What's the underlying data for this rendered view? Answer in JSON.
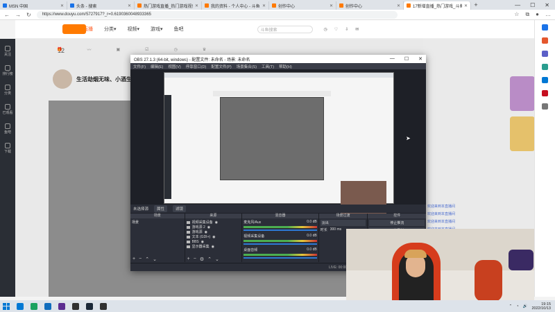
{
  "browser": {
    "tabs": [
      {
        "title": "MSN 中国",
        "color": "#1a73e8",
        "active": false
      },
      {
        "title": "头条 - 搜索",
        "color": "#1a73e8",
        "active": false
      },
      {
        "title": "热门游戏直播_热门游戏视频_热…",
        "color": "#ff7a00",
        "active": false
      },
      {
        "title": "我的资料 - 个人中心 - 斗鱼",
        "color": "#ff7a00",
        "active": false
      },
      {
        "title": "创作中心",
        "color": "#ff7a00",
        "active": false
      },
      {
        "title": "创作中心",
        "color": "#ff7a00",
        "active": false
      },
      {
        "title": "17新增直播_热门游戏_斗鱼…",
        "color": "#ff7a00",
        "active": true
      }
    ],
    "new_tab": "+",
    "window_controls": [
      "—",
      "☐",
      "✕"
    ],
    "url": "https://www.douyu.com/5727917?_r=0.6190360048933365",
    "nav_icons": [
      "←",
      "→",
      "↻"
    ]
  },
  "site": {
    "nav": [
      "首页",
      "直播",
      "分类▾",
      "视频▾",
      "游戏▾",
      "鱼吧"
    ],
    "search_placeholder": "斗鱼搜索",
    "big_number": "12",
    "room_title": "生活劫烟无味、小酒生",
    "left_nav": [
      "关注",
      "排行榜",
      "分类",
      "已观看",
      "鱼吧",
      "下载"
    ],
    "chat_lines": [
      "欢迎来到本直播间",
      "欢迎来到本直播间",
      "欢迎来到本直播间",
      "欢迎来到本直播间"
    ]
  },
  "obs": {
    "title": "OBS 27.1.3 (64-bit, windows) - 配置文件: 未命名 - 场景: 未命名",
    "menu": [
      "文件(F)",
      "编辑(E)",
      "视图(V)",
      "停靠窗口(D)",
      "配置文件(P)",
      "场景集合(S)",
      "工具(T)",
      "帮助(H)"
    ],
    "status_row": {
      "selection": "未选择源",
      "properties": "属性",
      "filters": "滤镜"
    },
    "docks": {
      "scenes": {
        "title": "场景",
        "items": [
          "场景"
        ]
      },
      "sources": {
        "title": "来源",
        "items": [
          "视频采集设备",
          "游戏源 2",
          "游戏源",
          "文本 (GDI+)",
          "BBS",
          "显示器采集"
        ]
      },
      "mixer": {
        "title": "混音器",
        "items": [
          "麦克风/Aux",
          "视频采集设备",
          "桌面音频"
        ],
        "db": [
          "0.0 dB",
          "0.0 dB",
          "0.0 dB"
        ]
      },
      "transitions": {
        "title": "场景过渡",
        "selected": "淡出",
        "duration_label": "时长",
        "duration": "300 ms"
      },
      "controls": {
        "title": "控件",
        "buttons": [
          "停止推流",
          "开始录制",
          "启动虚拟摄像机",
          "工作室模式",
          "设置",
          "退出"
        ]
      }
    },
    "bottom": [
      "LIVE: 00:00:00",
      "REC: 00:00:00",
      "CPU: 1.2%, 30.00 fps"
    ]
  },
  "taskbar": {
    "time": "19:15",
    "date": "2022/10/13",
    "app_colors": [
      "#0078d4",
      "#1aa260",
      "#0f6cbd",
      "#5c2d91",
      "#303030",
      "#1b2838",
      "#303030"
    ]
  }
}
